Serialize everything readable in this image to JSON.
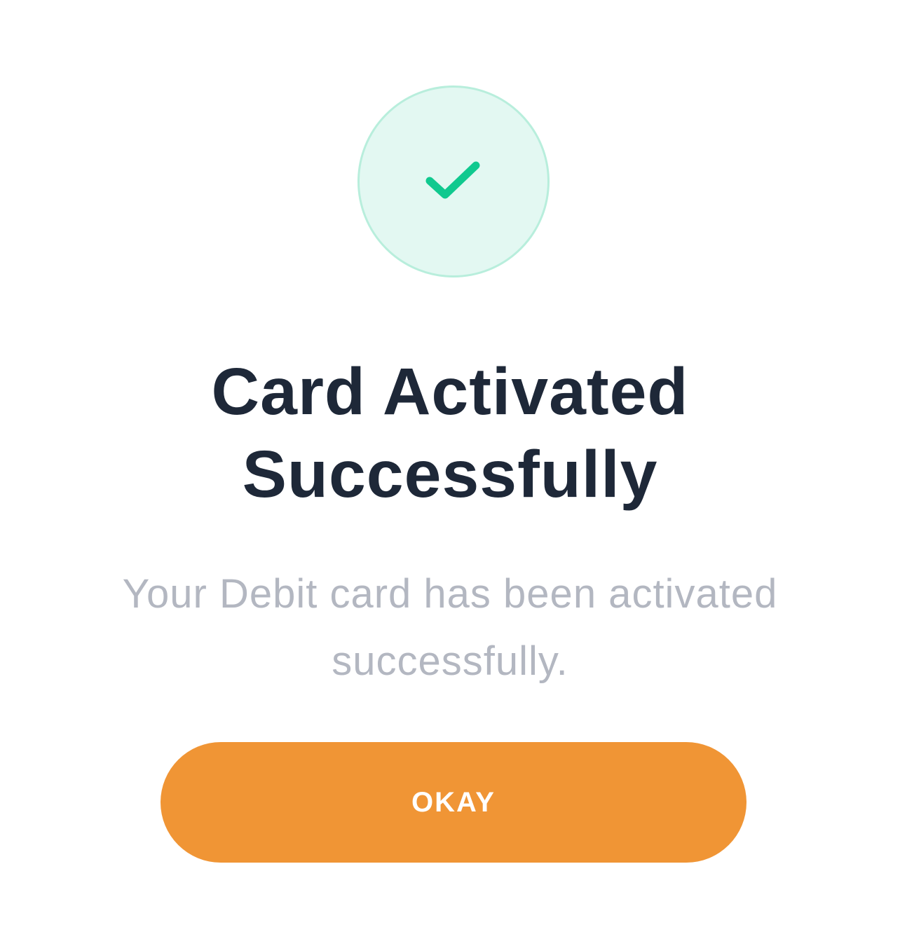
{
  "dialog": {
    "icon": "checkmark-icon",
    "title_line1": "Card Activated",
    "title_line2": "Successfully",
    "message_line1": "Your Debit card has been activated",
    "message_line2": "successfully.",
    "button_label": "OKAY"
  },
  "colors": {
    "success_green": "#10c98f",
    "success_circle_bg": "#e3f8f2",
    "title_text": "#1e2838",
    "message_text": "#b3b7c1",
    "button_orange": "#f09535",
    "button_text": "#ffffff"
  }
}
